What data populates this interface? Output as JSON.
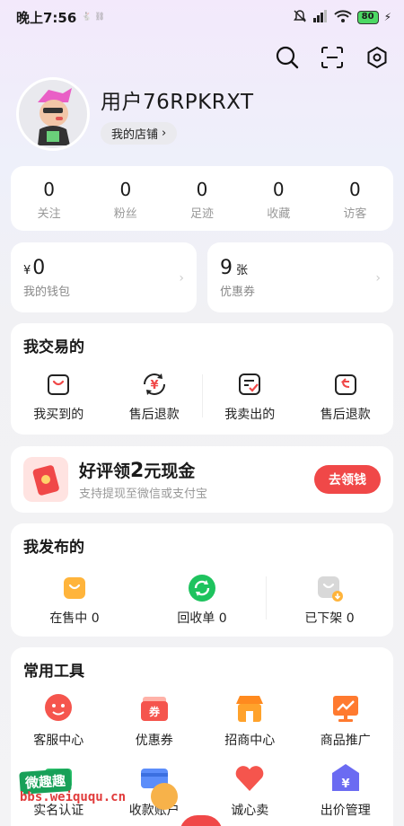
{
  "status_bar": {
    "time": "晚上7:56",
    "small_icons": "🐇 ⛓",
    "network": "HD",
    "battery": "80"
  },
  "profile": {
    "username": "用户76RPKRXT",
    "shop_label": "我的店铺"
  },
  "stats": [
    {
      "value": "0",
      "label": "关注"
    },
    {
      "value": "0",
      "label": "粉丝"
    },
    {
      "value": "0",
      "label": "足迹"
    },
    {
      "value": "0",
      "label": "收藏"
    },
    {
      "value": "0",
      "label": "访客"
    }
  ],
  "wallet": {
    "currency": "¥",
    "value": "0",
    "label": "我的钱包"
  },
  "coupons": {
    "value": "9",
    "unit": "张",
    "label": "优惠券"
  },
  "trade": {
    "title": "我交易的",
    "items": [
      {
        "label": "我买到的",
        "icon": "shopping-bag-icon"
      },
      {
        "label": "售后退款",
        "icon": "yuan-refresh-icon"
      },
      {
        "label": "我卖出的",
        "icon": "sold-check-icon"
      },
      {
        "label": "售后退款",
        "icon": "return-refund-icon"
      }
    ]
  },
  "promo": {
    "title_pre": "好评领",
    "title_num": "2",
    "title_post": "元现金",
    "subtitle": "支持提现至微信或支付宝",
    "button": "去领钱"
  },
  "publish": {
    "title": "我发布的",
    "items": [
      {
        "label": "在售中 0",
        "icon": "on-sale-bag-icon",
        "color": "#ffb43b"
      },
      {
        "label": "回收单 0",
        "icon": "recycle-icon",
        "color": "#1ec35e"
      },
      {
        "label": "已下架 0",
        "icon": "off-shelf-icon",
        "color": "#d8d8d8"
      }
    ]
  },
  "tools": {
    "title": "常用工具",
    "items": [
      {
        "label": "客服中心",
        "icon": "customer-service-icon",
        "color": "#f5554d"
      },
      {
        "label": "优惠券",
        "icon": "coupon-icon",
        "color": "#f5554d"
      },
      {
        "label": "招商中心",
        "icon": "store-icon",
        "color": "#ff9a1f"
      },
      {
        "label": "商品推广",
        "icon": "promotion-chart-icon",
        "color": "#ff7a2f"
      },
      {
        "label": "实名认证",
        "icon": "id-verify-icon",
        "color": "#2bc26b"
      },
      {
        "label": "收款账户",
        "icon": "payment-card-icon",
        "color": "#5b8dfa"
      },
      {
        "label": "诚心卖",
        "icon": "heart-sell-icon",
        "color": "#f5554d"
      },
      {
        "label": "出价管理",
        "icon": "bid-manage-icon",
        "color": "#6b6bf2"
      }
    ]
  },
  "watermark": {
    "badge": "微趣趣",
    "url": "bbs.weiququ.cn"
  }
}
